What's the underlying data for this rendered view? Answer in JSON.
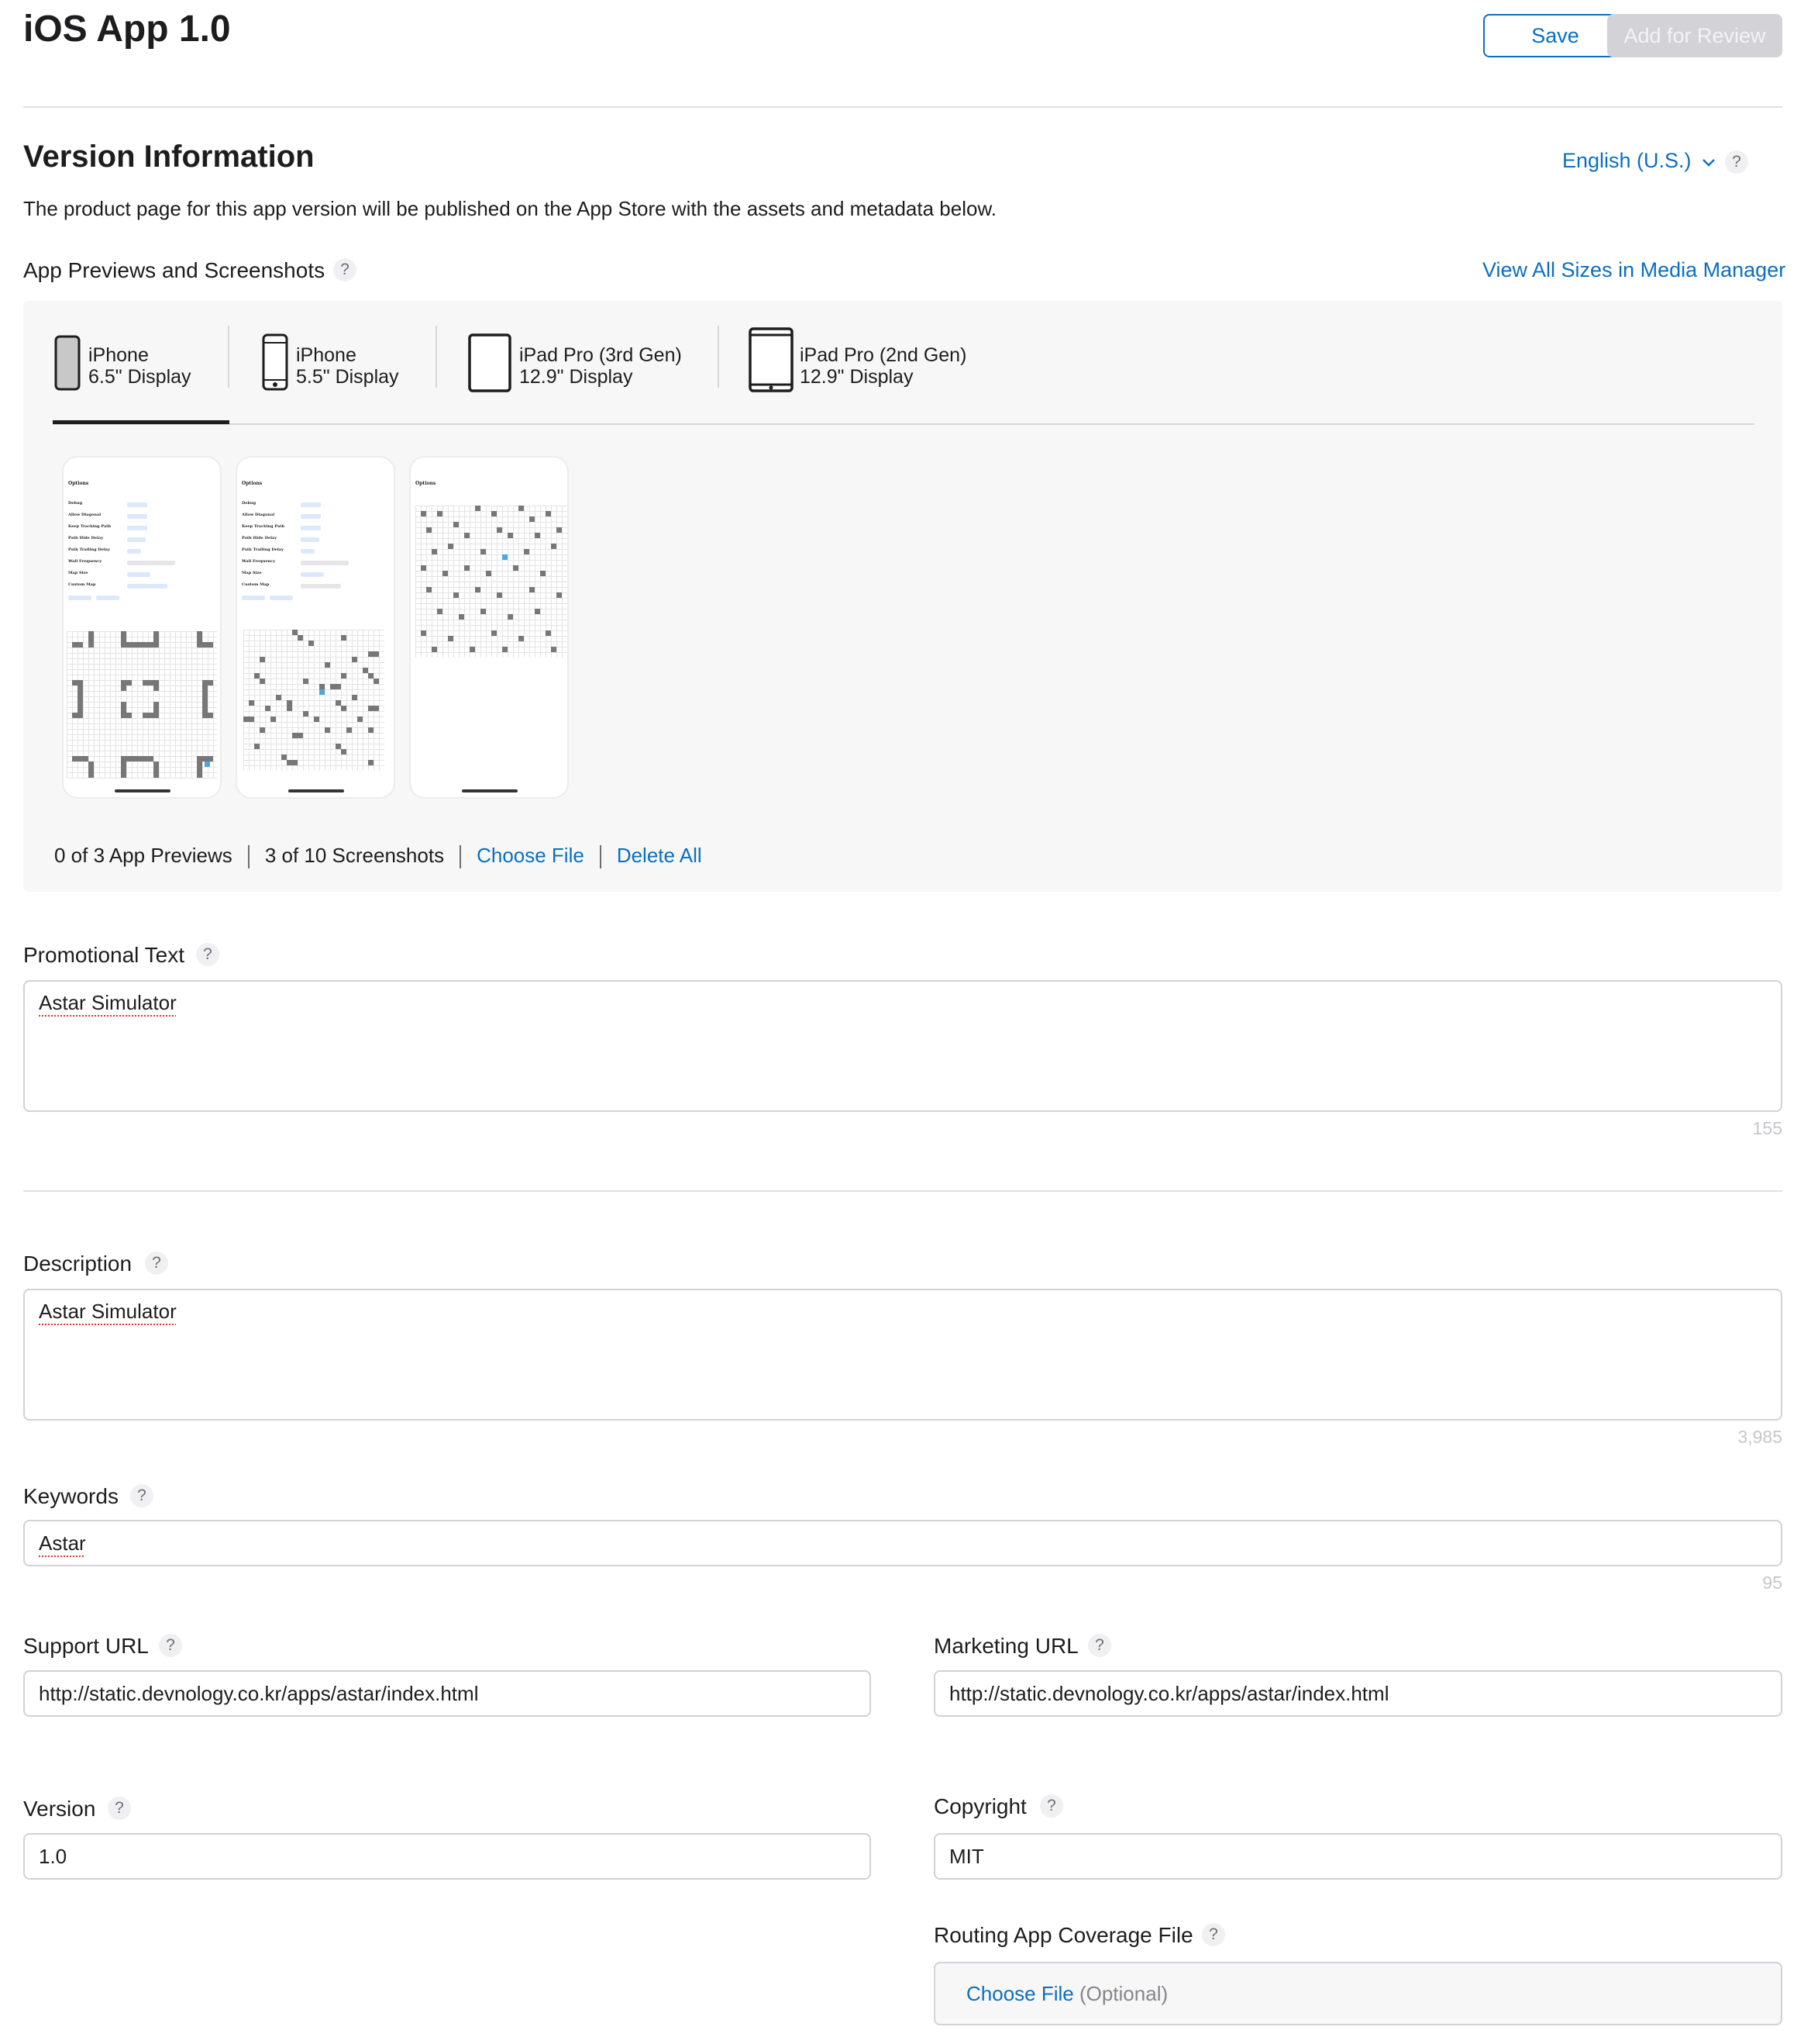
{
  "header": {
    "title": "iOS App 1.0",
    "save_label": "Save",
    "review_label": "Add for Review"
  },
  "version_info": {
    "title": "Version Information",
    "language": "English (U.S.)",
    "help": "?",
    "description": "The product page for this app version will be published on the App Store with the assets and metadata below."
  },
  "media": {
    "label": "App Previews and Screenshots",
    "help": "?",
    "view_all_link": "View All Sizes in Media Manager",
    "tabs": [
      {
        "line1": "iPhone",
        "line2": "6.5\" Display",
        "selected": true
      },
      {
        "line1": "iPhone",
        "line2": "5.5\" Display",
        "selected": false
      },
      {
        "line1": "iPad Pro (3rd Gen)",
        "line2": "12.9\" Display",
        "selected": false
      },
      {
        "line1": "iPad Pro (2nd Gen)",
        "line2": "12.9\" Display",
        "selected": false
      }
    ],
    "screenshot_content": {
      "title": "Options",
      "rows": [
        "Debug",
        "Allow Diagonal",
        "Keep Tracking Path",
        "Path Hide Delay",
        "Path Trailing Delay",
        "Wall Frequency",
        "Map Size",
        "Custom Map"
      ]
    },
    "previews_count": "0 of 3 App Previews",
    "screenshots_count": "3 of 10 Screenshots",
    "choose_file": "Choose File",
    "delete_all": "Delete All"
  },
  "promotional_text": {
    "label": "Promotional Text",
    "help": "?",
    "value": "Astar Simulator",
    "counter": "155"
  },
  "description": {
    "label": "Description",
    "help": "?",
    "value": "Astar Simulator",
    "counter": "3,985"
  },
  "keywords": {
    "label": "Keywords",
    "help": "?",
    "value": "Astar",
    "counter": "95"
  },
  "support_url": {
    "label": "Support URL",
    "help": "?",
    "value": "http://static.devnology.co.kr/apps/astar/index.html"
  },
  "marketing_url": {
    "label": "Marketing URL",
    "help": "?",
    "value": "http://static.devnology.co.kr/apps/astar/index.html"
  },
  "version": {
    "label": "Version",
    "help": "?",
    "value": "1.0"
  },
  "copyright": {
    "label": "Copyright",
    "help": "?",
    "value": "MIT"
  },
  "routing": {
    "label": "Routing App Coverage File",
    "help": "?",
    "choose_file": "Choose File",
    "optional": "(Optional)"
  },
  "colors": {
    "accent": "#0a6fc2",
    "disabled_button": "#d2d2d7",
    "panel_background": "#f7f7f7"
  }
}
